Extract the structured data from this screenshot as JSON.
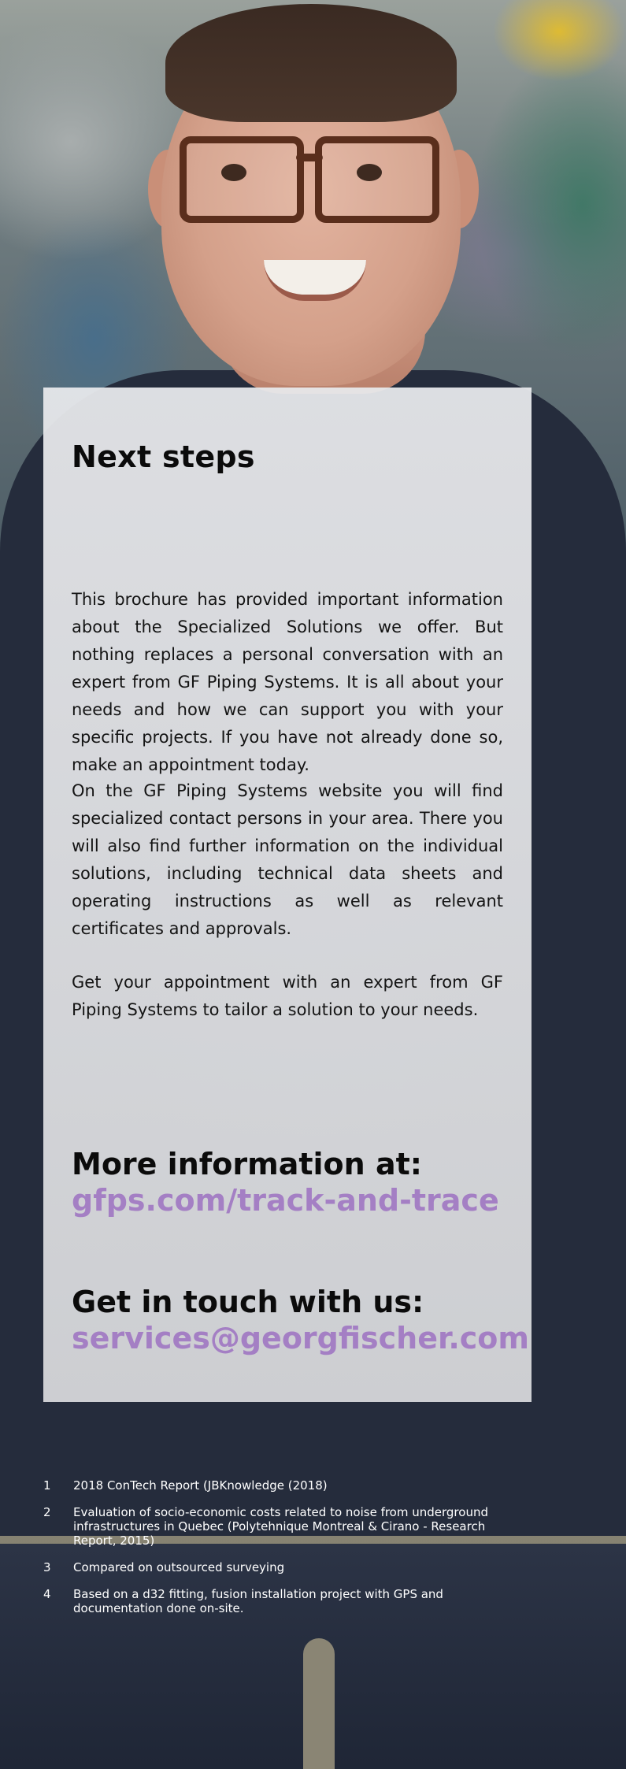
{
  "card": {
    "title": "Next steps",
    "paragraphs": [
      "This brochure has provided important information about the Specialized Solutions we offer. But nothing replaces a personal conversation with an expert from GF Piping Systems. It is all about your needs and how we can support you with your specific projects. If you have not already done so, make an appointment today.",
      "On the GF Piping Systems website you will find specialized contact persons in your area. There you will also find further information on the individual solutions, including technical data sheets and operating instructions as well as relevant certificates and approvals.",
      "Get your appointment with an expert from GF Piping Systems to tailor a solution to your needs."
    ],
    "more_info_label": "More information at:",
    "more_info_link": "gfps.com/track-and-trace",
    "contact_label": "Get in touch with us:",
    "contact_link": "services@georgfischer.com"
  },
  "footnotes": [
    {
      "num": "1",
      "text": "2018 ConTech Report (JBKnowledge (2018)"
    },
    {
      "num": "2",
      "text": "Evaluation of socio-economic costs related to noise from underground infrastructures in Quebec (Polytehnique Montreal & Cirano - Research Report, 2015)"
    },
    {
      "num": "3",
      "text": "Compared on outsourced surveying"
    },
    {
      "num": "4",
      "text": "Based on a d32 fitting, fusion installation project with GPS and documentation done on-site."
    }
  ],
  "colors": {
    "link": "#a47fc4",
    "card": "#dcdde0",
    "text": "#0b0b0b"
  }
}
